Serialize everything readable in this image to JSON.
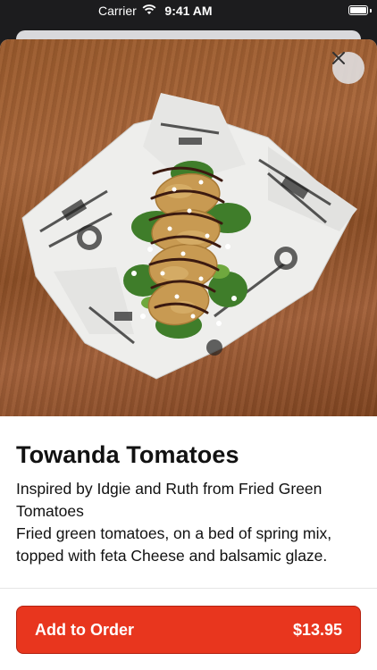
{
  "status_bar": {
    "carrier": "Carrier",
    "time": "9:41 AM"
  },
  "item": {
    "title": "Towanda Tomatoes",
    "description_line1": "Inspired by Idgie and Ruth from Fried Green Tomatoes",
    "description_line2": "Fried green tomatoes, on a bed of spring mix, topped  with feta Cheese and balsamic glaze."
  },
  "order": {
    "label": "Add to Order",
    "price": "$13.95"
  },
  "colors": {
    "accent": "#e8361e",
    "sheet": "#ffffff",
    "wood": "#9a5a2c"
  },
  "icons": {
    "close": "close-icon",
    "wifi": "wifi-icon",
    "battery": "battery-icon"
  }
}
